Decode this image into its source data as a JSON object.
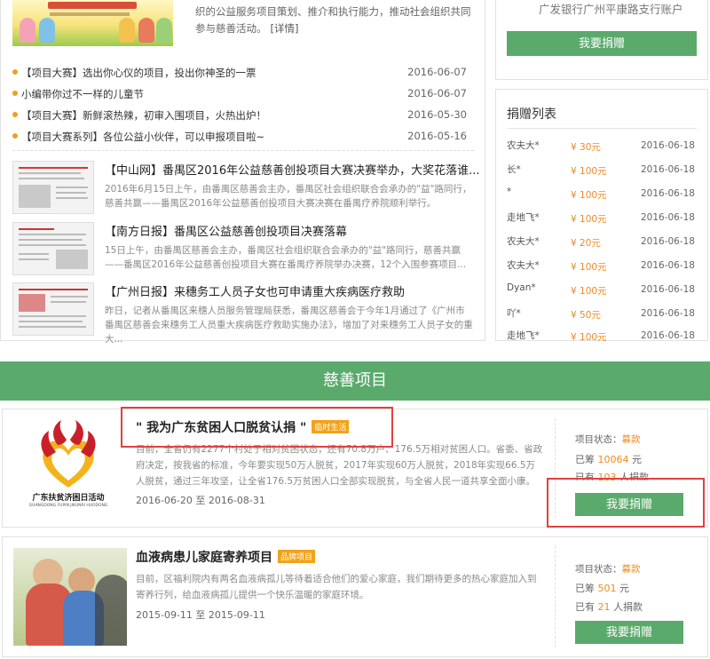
{
  "feature": {
    "description": "织的公益服务项目策划、推介和执行能力，推动社会组织共同参与慈善活动。",
    "more_label": "[详情]"
  },
  "news": [
    {
      "title": "【项目大赛】选出你心仪的项目，投出你神圣的一票",
      "date": "2016-06-07"
    },
    {
      "title": "小编带你过不一样的儿童节",
      "date": "2016-06-07"
    },
    {
      "title": "【项目大赛】新鲜滚热辣，初审入围项目，火热出炉！",
      "date": "2016-05-30"
    },
    {
      "title": "【项目大赛系列】各位公益小伙伴，可以申报项目啦~",
      "date": "2016-05-16"
    }
  ],
  "media": [
    {
      "title": "【中山网】番禺区2016年公益慈善创投项目大赛决赛举办，大奖花落谁...",
      "desc": "2016年6月15日上午，由番禺区慈善会主办，番禺区社会组织联合会承办的\"益\"路同行，慈善共赢——番禺区2016年公益慈善创投项目大赛决赛在番禺疗养院顺利举行。"
    },
    {
      "title": "【南方日报】番禺区公益慈善创投项目决赛落幕",
      "desc": "15日上午，由番禺区慈善会主办，番禺区社会组织联合会承办的\"益\"路同行，慈善共赢——番禺区2016年公益慈善创投项目大赛在番禺疗养院举办决赛，12个入围参赛项目..."
    },
    {
      "title": "【广州日报】来穗务工人员子女也可申请重大疾病医疗救助",
      "desc": "昨日，记者从番禺区来穗人员服务管理局获悉，番禺区慈善会于今年1月通过了《广州市番禺区慈善会来穗务工人员重大疾病医疗救助实施办法》，增加了对来穗务工人员子女的重大..."
    }
  ],
  "bank": {
    "text": "广发银行广州平康路支行账户",
    "donate_label": "我要捐赠"
  },
  "donors": {
    "title": "捐赠列表",
    "rows": [
      {
        "name": "农夫大*",
        "amount": "¥ 30元",
        "date": "2016-06-18"
      },
      {
        "name": "长*",
        "amount": "¥ 100元",
        "date": "2016-06-18"
      },
      {
        "name": "*",
        "amount": "¥ 100元",
        "date": "2016-06-18"
      },
      {
        "name": "走地飞*",
        "amount": "¥ 100元",
        "date": "2016-06-18"
      },
      {
        "name": "农夫大*",
        "amount": "¥ 20元",
        "date": "2016-06-18"
      },
      {
        "name": "农夫大*",
        "amount": "¥ 100元",
        "date": "2016-06-18"
      },
      {
        "name": "Dyan*",
        "amount": "¥ 100元",
        "date": "2016-06-18"
      },
      {
        "name": "吖*",
        "amount": "¥ 50元",
        "date": "2016-06-18"
      },
      {
        "name": "走地飞*",
        "amount": "¥ 100元",
        "date": "2016-06-18"
      }
    ]
  },
  "section_title": "慈善项目",
  "projects": [
    {
      "title": "\" 我为广东贫困人口脱贫认捐 \"",
      "tag": "临时生活",
      "desc": "目前，全省仍有2277个村处于相对贫困状态，还有70.8万户、176.5万相对贫困人口。省委、省政府决定，按我省的标准，今年要实现50万人脱贫，2017年实现60万人脱贫，2018年实现66.5万人脱贫，通过三年攻坚，让全省176.5万贫困人口全部实现脱贫，与全省人民一道共享全面小康。",
      "dates": "2016-06-20 至 2016-08-31",
      "logo_text": "广东扶贫济困日活动",
      "logo_sub": "GUANGDONG FUPIN JIKUNRI HUODONG",
      "status_label": "项目状态：",
      "status": "募款",
      "raised_prefix": "已筹",
      "raised": "10064",
      "raised_unit": "元",
      "donors_prefix": "已有",
      "donors_count": "103",
      "donors_unit": "人捐款",
      "donate_label": "我要捐赠"
    },
    {
      "title": "血液病患儿家庭寄养项目",
      "tag": "品牌项目",
      "desc": "目前，区福利院内有两名血液病孤儿等待着适合他们的爱心家庭，我们期待更多的热心家庭加入到寄养行列，给血液病孤儿提供一个快乐温暖的家庭环境。",
      "dates": "2015-09-11 至 2015-09-11",
      "status_label": "项目状态：",
      "status": "募款",
      "raised_prefix": "已筹",
      "raised": "501",
      "raised_unit": "元",
      "donors_prefix": "已有",
      "donors_count": "21",
      "donors_unit": "人捐款",
      "donate_label": "我要捐赠"
    }
  ],
  "colors": {
    "brand_green": "#5aaa6c",
    "accent_orange": "#f08a1c",
    "tag_orange": "#f1a31a",
    "highlight_red": "#e44040"
  }
}
